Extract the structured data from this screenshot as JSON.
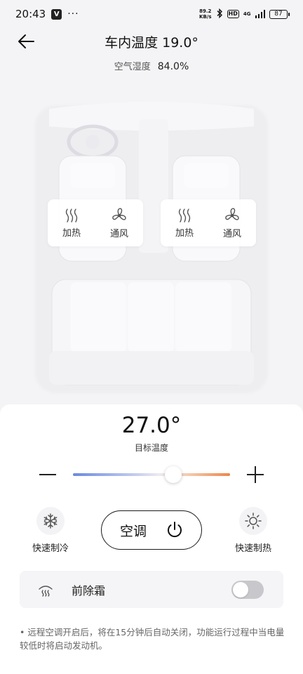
{
  "status_bar": {
    "time": "20:43",
    "app_badge": "V",
    "more": "···",
    "net_speed_value": "89.2",
    "net_speed_unit": "KB/s",
    "hd": "HD",
    "network": "4G",
    "battery": "87"
  },
  "header": {
    "title": "车内温度 19.0°"
  },
  "humidity": {
    "label": "空气湿度",
    "value": "84.0%"
  },
  "seats": {
    "left": {
      "heat_label": "加热",
      "vent_label": "通风"
    },
    "right": {
      "heat_label": "加热",
      "vent_label": "通风"
    }
  },
  "climate": {
    "target_temp": "27.0°",
    "target_label": "目标温度",
    "slider_fraction": 0.64,
    "slider_colors": {
      "cold": "#6a8ae0",
      "hot": "#ef8448"
    }
  },
  "quick_actions": {
    "cool_label": "快速制冷",
    "heat_label": "快速制热"
  },
  "ac_button": {
    "label": "空调"
  },
  "defrost": {
    "label": "前除霜",
    "enabled": false
  },
  "notice": "•  远程空调开启后，将在15分钟后自动关闭，功能运行过程中当电量较低时将启动发动机。",
  "icons": {
    "back": "arrow-left-icon",
    "heat": "heat-waves-icon",
    "vent": "fan-icon",
    "cool": "snowflake-icon",
    "sun": "sun-icon",
    "power": "power-icon",
    "defrost": "windshield-defrost-icon"
  }
}
